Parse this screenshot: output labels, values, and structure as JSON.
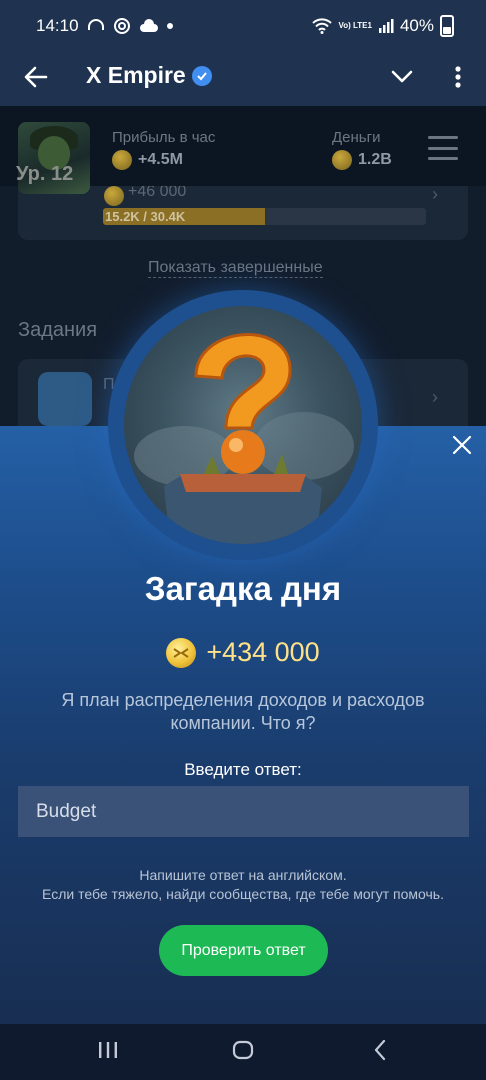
{
  "status_bar": {
    "time": "14:10",
    "battery": "40%",
    "volte": "Vo) LTE1",
    "icons": [
      "headphones-icon",
      "at-icon",
      "cloud-icon",
      "dot-icon",
      "wifi-icon",
      "volte-icon",
      "signal-icon",
      "battery-icon"
    ]
  },
  "app_bar": {
    "title": "X Empire",
    "icons": [
      "back-arrow-icon",
      "verified-icon",
      "chevron-down-icon",
      "more-vert-icon"
    ]
  },
  "background": {
    "level": "Ур. 12",
    "profit_label": "Прибыль в час",
    "profit_value": "+4.5M",
    "money_label": "Деньги",
    "money_value": "1.2B",
    "task_reward": "+46 000",
    "progress_text": "15.2K / 30.4K",
    "progress_fraction": 0.5,
    "show_completed": "Показать завершенные",
    "tasks_title": "Задания",
    "task2_label": "Под"
  },
  "modal": {
    "title": "Загадка дня",
    "reward": "+434 000",
    "question": "Я план распределения доходов и расходов компании. Что я?",
    "answer_label": "Введите ответ:",
    "answer_value": "Budget",
    "hint_line1": "Напишите ответ на английском.",
    "hint_line2": "Если тебе тяжело, найди сообщества, где тебе могут помочь.",
    "check_button": "Проверить ответ"
  },
  "colors": {
    "accent_green": "#1db954",
    "coin_gold": "#f0c33a",
    "verified_blue": "#3f8ef0",
    "sheet_blue": "#2560a6"
  }
}
